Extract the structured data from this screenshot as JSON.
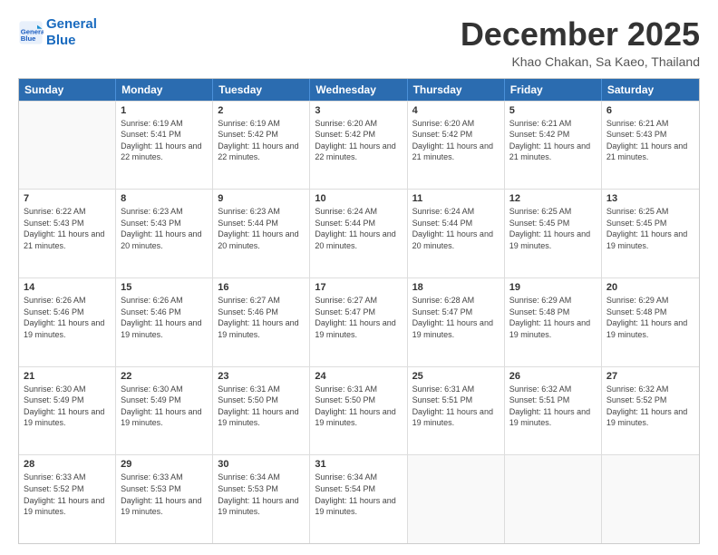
{
  "header": {
    "logo_line1": "General",
    "logo_line2": "Blue",
    "month_title": "December 2025",
    "location": "Khao Chakan, Sa Kaeo, Thailand"
  },
  "days_of_week": [
    "Sunday",
    "Monday",
    "Tuesday",
    "Wednesday",
    "Thursday",
    "Friday",
    "Saturday"
  ],
  "weeks": [
    [
      {
        "day": "",
        "sunrise": "",
        "sunset": "",
        "daylight": ""
      },
      {
        "day": "1",
        "sunrise": "Sunrise: 6:19 AM",
        "sunset": "Sunset: 5:41 PM",
        "daylight": "Daylight: 11 hours and 22 minutes."
      },
      {
        "day": "2",
        "sunrise": "Sunrise: 6:19 AM",
        "sunset": "Sunset: 5:42 PM",
        "daylight": "Daylight: 11 hours and 22 minutes."
      },
      {
        "day": "3",
        "sunrise": "Sunrise: 6:20 AM",
        "sunset": "Sunset: 5:42 PM",
        "daylight": "Daylight: 11 hours and 22 minutes."
      },
      {
        "day": "4",
        "sunrise": "Sunrise: 6:20 AM",
        "sunset": "Sunset: 5:42 PM",
        "daylight": "Daylight: 11 hours and 21 minutes."
      },
      {
        "day": "5",
        "sunrise": "Sunrise: 6:21 AM",
        "sunset": "Sunset: 5:42 PM",
        "daylight": "Daylight: 11 hours and 21 minutes."
      },
      {
        "day": "6",
        "sunrise": "Sunrise: 6:21 AM",
        "sunset": "Sunset: 5:43 PM",
        "daylight": "Daylight: 11 hours and 21 minutes."
      }
    ],
    [
      {
        "day": "7",
        "sunrise": "Sunrise: 6:22 AM",
        "sunset": "Sunset: 5:43 PM",
        "daylight": "Daylight: 11 hours and 21 minutes."
      },
      {
        "day": "8",
        "sunrise": "Sunrise: 6:23 AM",
        "sunset": "Sunset: 5:43 PM",
        "daylight": "Daylight: 11 hours and 20 minutes."
      },
      {
        "day": "9",
        "sunrise": "Sunrise: 6:23 AM",
        "sunset": "Sunset: 5:44 PM",
        "daylight": "Daylight: 11 hours and 20 minutes."
      },
      {
        "day": "10",
        "sunrise": "Sunrise: 6:24 AM",
        "sunset": "Sunset: 5:44 PM",
        "daylight": "Daylight: 11 hours and 20 minutes."
      },
      {
        "day": "11",
        "sunrise": "Sunrise: 6:24 AM",
        "sunset": "Sunset: 5:44 PM",
        "daylight": "Daylight: 11 hours and 20 minutes."
      },
      {
        "day": "12",
        "sunrise": "Sunrise: 6:25 AM",
        "sunset": "Sunset: 5:45 PM",
        "daylight": "Daylight: 11 hours and 19 minutes."
      },
      {
        "day": "13",
        "sunrise": "Sunrise: 6:25 AM",
        "sunset": "Sunset: 5:45 PM",
        "daylight": "Daylight: 11 hours and 19 minutes."
      }
    ],
    [
      {
        "day": "14",
        "sunrise": "Sunrise: 6:26 AM",
        "sunset": "Sunset: 5:46 PM",
        "daylight": "Daylight: 11 hours and 19 minutes."
      },
      {
        "day": "15",
        "sunrise": "Sunrise: 6:26 AM",
        "sunset": "Sunset: 5:46 PM",
        "daylight": "Daylight: 11 hours and 19 minutes."
      },
      {
        "day": "16",
        "sunrise": "Sunrise: 6:27 AM",
        "sunset": "Sunset: 5:46 PM",
        "daylight": "Daylight: 11 hours and 19 minutes."
      },
      {
        "day": "17",
        "sunrise": "Sunrise: 6:27 AM",
        "sunset": "Sunset: 5:47 PM",
        "daylight": "Daylight: 11 hours and 19 minutes."
      },
      {
        "day": "18",
        "sunrise": "Sunrise: 6:28 AM",
        "sunset": "Sunset: 5:47 PM",
        "daylight": "Daylight: 11 hours and 19 minutes."
      },
      {
        "day": "19",
        "sunrise": "Sunrise: 6:29 AM",
        "sunset": "Sunset: 5:48 PM",
        "daylight": "Daylight: 11 hours and 19 minutes."
      },
      {
        "day": "20",
        "sunrise": "Sunrise: 6:29 AM",
        "sunset": "Sunset: 5:48 PM",
        "daylight": "Daylight: 11 hours and 19 minutes."
      }
    ],
    [
      {
        "day": "21",
        "sunrise": "Sunrise: 6:30 AM",
        "sunset": "Sunset: 5:49 PM",
        "daylight": "Daylight: 11 hours and 19 minutes."
      },
      {
        "day": "22",
        "sunrise": "Sunrise: 6:30 AM",
        "sunset": "Sunset: 5:49 PM",
        "daylight": "Daylight: 11 hours and 19 minutes."
      },
      {
        "day": "23",
        "sunrise": "Sunrise: 6:31 AM",
        "sunset": "Sunset: 5:50 PM",
        "daylight": "Daylight: 11 hours and 19 minutes."
      },
      {
        "day": "24",
        "sunrise": "Sunrise: 6:31 AM",
        "sunset": "Sunset: 5:50 PM",
        "daylight": "Daylight: 11 hours and 19 minutes."
      },
      {
        "day": "25",
        "sunrise": "Sunrise: 6:31 AM",
        "sunset": "Sunset: 5:51 PM",
        "daylight": "Daylight: 11 hours and 19 minutes."
      },
      {
        "day": "26",
        "sunrise": "Sunrise: 6:32 AM",
        "sunset": "Sunset: 5:51 PM",
        "daylight": "Daylight: 11 hours and 19 minutes."
      },
      {
        "day": "27",
        "sunrise": "Sunrise: 6:32 AM",
        "sunset": "Sunset: 5:52 PM",
        "daylight": "Daylight: 11 hours and 19 minutes."
      }
    ],
    [
      {
        "day": "28",
        "sunrise": "Sunrise: 6:33 AM",
        "sunset": "Sunset: 5:52 PM",
        "daylight": "Daylight: 11 hours and 19 minutes."
      },
      {
        "day": "29",
        "sunrise": "Sunrise: 6:33 AM",
        "sunset": "Sunset: 5:53 PM",
        "daylight": "Daylight: 11 hours and 19 minutes."
      },
      {
        "day": "30",
        "sunrise": "Sunrise: 6:34 AM",
        "sunset": "Sunset: 5:53 PM",
        "daylight": "Daylight: 11 hours and 19 minutes."
      },
      {
        "day": "31",
        "sunrise": "Sunrise: 6:34 AM",
        "sunset": "Sunset: 5:54 PM",
        "daylight": "Daylight: 11 hours and 19 minutes."
      },
      {
        "day": "",
        "sunrise": "",
        "sunset": "",
        "daylight": ""
      },
      {
        "day": "",
        "sunrise": "",
        "sunset": "",
        "daylight": ""
      },
      {
        "day": "",
        "sunrise": "",
        "sunset": "",
        "daylight": ""
      }
    ]
  ]
}
